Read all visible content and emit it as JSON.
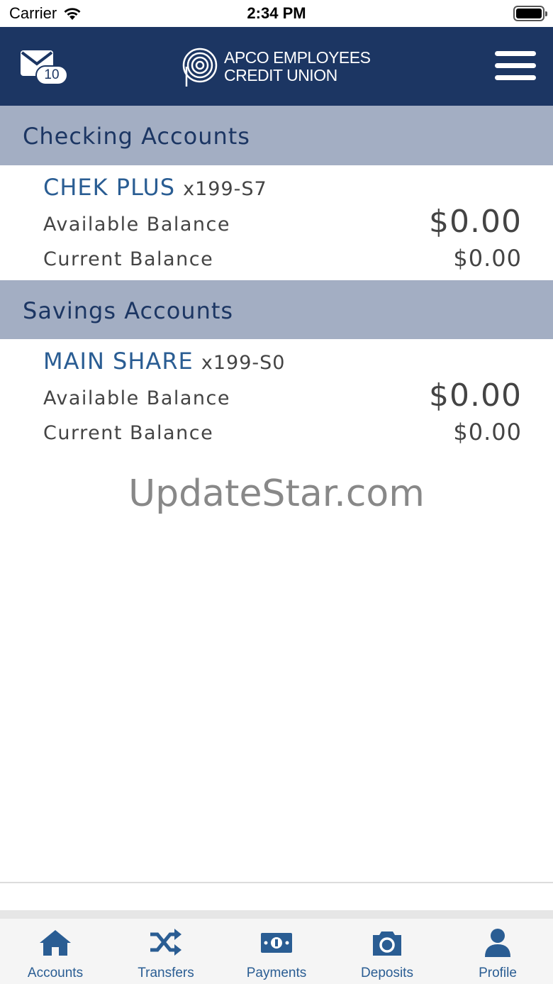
{
  "status_bar": {
    "carrier": "Carrier",
    "time": "2:34 PM"
  },
  "header": {
    "message_count": "10",
    "logo_line1": "APCO EMPLOYEES",
    "logo_line2": "CREDIT UNION",
    "brand_color": "#1c3663"
  },
  "sections": [
    {
      "title": "Checking Accounts",
      "accounts": [
        {
          "name": "CHEK PLUS",
          "number": "x199-S7",
          "available_label": "Available Balance",
          "available_value": "$0.00",
          "current_label": "Current Balance",
          "current_value": "$0.00"
        }
      ]
    },
    {
      "title": "Savings Accounts",
      "accounts": [
        {
          "name": "MAIN SHARE",
          "number": "x199-S0",
          "available_label": "Available Balance",
          "available_value": "$0.00",
          "current_label": "Current Balance",
          "current_value": "$0.00"
        }
      ]
    }
  ],
  "watermark": "UpdateStar.com",
  "tabs": [
    {
      "label": "Accounts",
      "icon": "home-icon"
    },
    {
      "label": "Transfers",
      "icon": "shuffle-icon"
    },
    {
      "label": "Payments",
      "icon": "money-icon"
    },
    {
      "label": "Deposits",
      "icon": "camera-icon"
    },
    {
      "label": "Profile",
      "icon": "person-icon"
    }
  ],
  "colors": {
    "section_header_bg": "#a3aec3",
    "account_name": "#2a5d93",
    "tab_accent": "#2a5d93"
  }
}
